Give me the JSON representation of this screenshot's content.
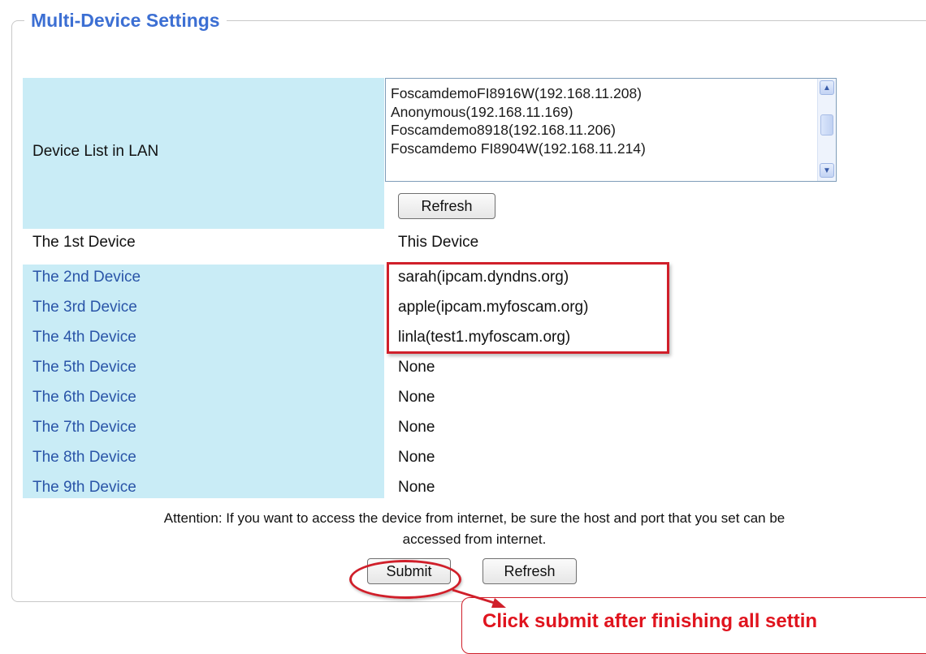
{
  "panel": {
    "title": "Multi-Device Settings"
  },
  "device_list": {
    "label": "Device List in LAN",
    "items": [
      "FoscamdemoFI8916W(192.168.11.208)",
      "Anonymous(192.168.11.169)",
      "Foscamdemo8918(192.168.11.206)",
      "Foscamdemo FI8904W(192.168.11.214)"
    ],
    "refresh_label": "Refresh"
  },
  "devices": [
    {
      "label": "The 1st Device",
      "value": "This Device"
    },
    {
      "label": "The 2nd Device",
      "value": "sarah(ipcam.dyndns.org)"
    },
    {
      "label": "The 3rd Device",
      "value": "apple(ipcam.myfoscam.org)"
    },
    {
      "label": "The 4th Device",
      "value": "linla(test1.myfoscam.org)"
    },
    {
      "label": "The 5th Device",
      "value": "None"
    },
    {
      "label": "The 6th Device",
      "value": "None"
    },
    {
      "label": "The 7th Device",
      "value": "None"
    },
    {
      "label": "The 8th Device",
      "value": "None"
    },
    {
      "label": "The 9th Device",
      "value": "None"
    }
  ],
  "attention": {
    "line1": "Attention: If you want to access the device from internet, be sure the host and port that you set can be",
    "line2": "accessed from internet."
  },
  "footer": {
    "submit_label": "Submit",
    "refresh_label": "Refresh"
  },
  "annotation": {
    "callout_text": "Click submit after finishing all settin"
  },
  "colors": {
    "title": "#3c6fd3",
    "label_bg": "#c9ecf6",
    "label_link": "#2a55a8",
    "highlight": "#d01f2a"
  }
}
